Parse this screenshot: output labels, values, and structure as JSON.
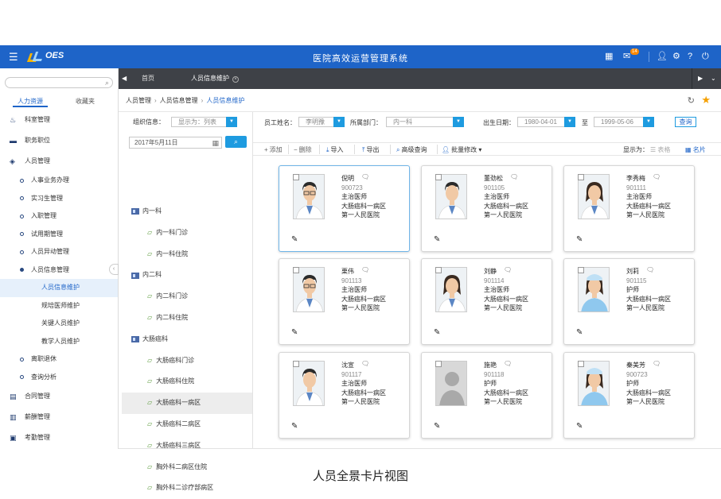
{
  "app": {
    "logo": "OES",
    "title": "医院高效运营管理系统"
  },
  "header_icons": {
    "notification_count": "14"
  },
  "sidebar": {
    "search_placeholder": "",
    "tabs": [
      {
        "label": "人力资源"
      },
      {
        "label": "收藏夹"
      }
    ],
    "items": [
      {
        "label": "科室管理",
        "icon": "hospital-icon"
      },
      {
        "label": "职务职位",
        "icon": "briefcase-icon"
      },
      {
        "label": "人员管理",
        "icon": "cube-icon"
      }
    ],
    "subitems": [
      {
        "label": "人事业务办理"
      },
      {
        "label": "实习生管理"
      },
      {
        "label": "入职管理"
      },
      {
        "label": "试用期管理"
      },
      {
        "label": "人员异动管理"
      },
      {
        "label": "人员信息管理"
      }
    ],
    "leaves": [
      {
        "label": "人员信息维护"
      },
      {
        "label": "规培医师维护"
      },
      {
        "label": "关键人员维护"
      },
      {
        "label": "教学人员维护"
      }
    ],
    "subitems2": [
      {
        "label": "离职退休"
      },
      {
        "label": "查询分析"
      }
    ],
    "items2": [
      {
        "label": "合同管理",
        "icon": "contract-icon"
      },
      {
        "label": "薪酬管理",
        "icon": "salary-icon"
      },
      {
        "label": "考勤管理",
        "icon": "attendance-icon"
      }
    ]
  },
  "tabbar": {
    "tabs": [
      {
        "label": "首页"
      },
      {
        "label": "人员信息维护"
      }
    ]
  },
  "breadcrumb": [
    "人员管理",
    "人员信息管理",
    "人员信息维护"
  ],
  "tree": {
    "org_label": "组织信息：",
    "display_select": "显示为：列表",
    "date": "2017年5月11日",
    "depts": [
      {
        "label": "内一科",
        "leaves": [
          "内一科门诊",
          "内一科住院"
        ]
      },
      {
        "label": "内二科",
        "leaves": [
          "内二科门诊",
          "内二科住院"
        ]
      },
      {
        "label": "大肠癌科",
        "leaves": [
          "大肠癌科门诊",
          "大肠癌科住院",
          "大肠癌科一病区",
          "大肠癌科二病区",
          "大肠癌科三病区",
          "胸外科二病区住院",
          "胸外科二诊疗部病区"
        ]
      }
    ]
  },
  "filter": {
    "name_label": "员工姓名：",
    "name_value": "李明豫",
    "dept_label": "所属部门：",
    "dept_value": "内一科",
    "birth_label": "出生日期：",
    "birth_from": "1980-04-01",
    "to_label": "至",
    "birth_to": "1999-05-06",
    "query_button": "查询"
  },
  "toolbar": {
    "add": "添加",
    "delete": "删除",
    "import": "导入",
    "export": "导出",
    "advanced": "高级查询",
    "batch": "批量修改",
    "display_label": "显示为：",
    "mode_table": "表格",
    "mode_card": "名片"
  },
  "cards": [
    {
      "name": "倪明",
      "id": "900723",
      "title": "主治医师",
      "ward": "大肠癌科一病区",
      "hospital": "第一人民医院",
      "avatar": "male-doctor-glasses",
      "selected": true
    },
    {
      "name": "董劲松",
      "id": "901105",
      "title": "主治医师",
      "ward": "大肠癌科一病区",
      "hospital": "第一人民医院",
      "avatar": "male-doctor"
    },
    {
      "name": "李秀梅",
      "id": "901111",
      "title": "主治医师",
      "ward": "大肠癌科一病区",
      "hospital": "第一人民医院",
      "avatar": "female-doctor"
    },
    {
      "name": "栗伟",
      "id": "901113",
      "title": "主治医师",
      "ward": "大肠癌科一病区",
      "hospital": "第一人民医院",
      "avatar": "male-doctor-glasses"
    },
    {
      "name": "刘静",
      "id": "901114",
      "title": "主治医师",
      "ward": "大肠癌科一病区",
      "hospital": "第一人民医院",
      "avatar": "female-doctor"
    },
    {
      "name": "刘莉",
      "id": "901115",
      "title": "护师",
      "ward": "大肠癌科一病区",
      "hospital": "第一人民医院",
      "avatar": "nurse"
    },
    {
      "name": "沈宣",
      "id": "901117",
      "title": "主治医师",
      "ward": "大肠癌科一病区",
      "hospital": "第一人民医院",
      "avatar": "male-doctor"
    },
    {
      "name": "施艳",
      "id": "901118",
      "title": "护师",
      "ward": "大肠癌科一病区",
      "hospital": "第一人民医院",
      "avatar": "placeholder"
    },
    {
      "name": "秦美芳",
      "id": "900723",
      "title": "护师",
      "ward": "大肠癌科一病区",
      "hospital": "第一人民医院",
      "avatar": "nurse"
    }
  ],
  "caption": "人员全景卡片视图",
  "colors": {
    "header": "#1e64c8",
    "accent": "#1e9be0",
    "tabbar": "#3e4147",
    "star": "#f5a000"
  }
}
